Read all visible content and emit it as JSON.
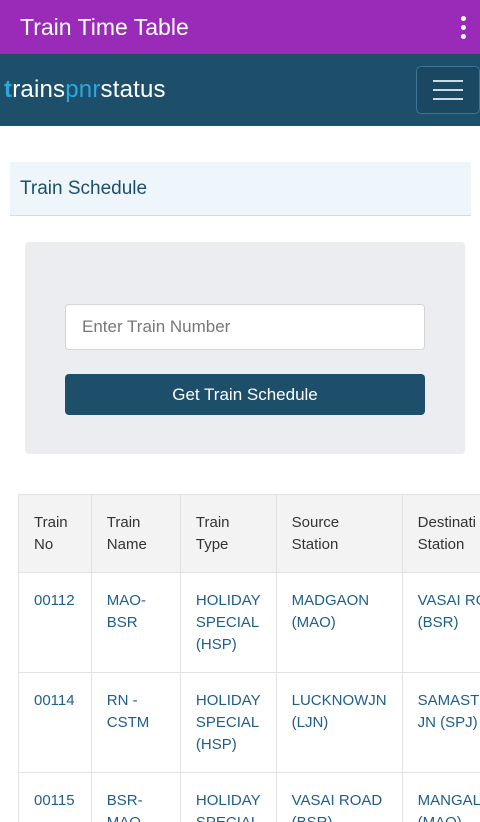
{
  "appbar": {
    "title": "Train Time Table",
    "menu_icon": "more-vert-icon"
  },
  "navbar": {
    "logo_t": "t",
    "logo_rains": "rains",
    "logo_pnr": "pnr",
    "logo_status": "status",
    "menu_icon": "hamburger-icon"
  },
  "section": {
    "title": "Train Schedule"
  },
  "form": {
    "placeholder": "Enter Train Number",
    "value": "",
    "button_label": "Get Train Schedule"
  },
  "table": {
    "headers": [
      [
        "Train",
        "No"
      ],
      [
        "Train",
        "Name"
      ],
      [
        "Train",
        "Type"
      ],
      [
        "Source",
        "Station"
      ],
      [
        "Destinati",
        "Station"
      ]
    ],
    "rows": [
      {
        "no": "00112",
        "name": [
          "MAO-",
          "BSR"
        ],
        "type": [
          "HOLIDAY",
          "SPECIAL",
          "(HSP)"
        ],
        "source": [
          "MADGAON",
          "(MAO)"
        ],
        "dest": [
          "VASAI RO",
          "(BSR)"
        ]
      },
      {
        "no": "00114",
        "name": [
          "RN -",
          "CSTM"
        ],
        "type": [
          "HOLIDAY",
          "SPECIAL",
          "(HSP)"
        ],
        "source": [
          "LUCKNOWJN",
          "(LJN)"
        ],
        "dest": [
          "SAMAST",
          "JN (SPJ)"
        ]
      },
      {
        "no": "00115",
        "name": [
          "BSR-",
          "MAQ"
        ],
        "type": [
          "HOLIDAY",
          "SPECIAL"
        ],
        "source": [
          "VASAI ROAD",
          "(BSR)"
        ],
        "dest": [
          "MANGAL",
          "(MAQ)"
        ]
      }
    ]
  },
  "colors": {
    "appbar": "#9a2bb8",
    "navbar": "#1d4f6a",
    "accent": "#2aa8e0",
    "button": "#1d4f6a",
    "link": "#1d5e8a"
  }
}
